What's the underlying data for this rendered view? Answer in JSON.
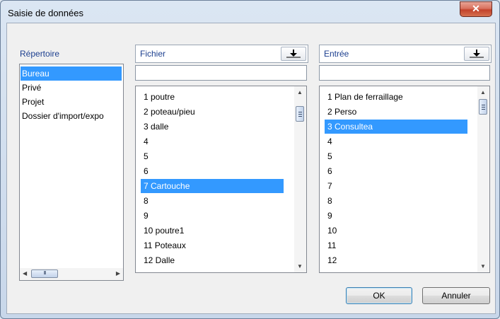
{
  "window": {
    "title": "Saisie de données",
    "close": "✕"
  },
  "directory": {
    "label": "Répertoire",
    "items": [
      "Bureau",
      "Privé",
      "Projet",
      "Dossier d'import/expo"
    ],
    "selected_index": 0,
    "hscroll_grip": "III"
  },
  "file": {
    "label": "Fichier",
    "input_value": "",
    "items": [
      "1 poutre",
      "2 poteau/pieu",
      "3 dalle",
      "4",
      "5",
      "6",
      "7 Cartouche",
      "8",
      "9",
      "10 poutre1",
      "11 Poteaux",
      "12 Dalle"
    ],
    "selected_index": 6,
    "icon": "download-icon"
  },
  "entry": {
    "label": "Entrée",
    "input_value": "",
    "items": [
      "1 Plan de ferraillage",
      "2 Perso",
      "3 Consultea",
      "4",
      "5",
      "6",
      "7",
      "8",
      "9",
      "10",
      "11",
      "12"
    ],
    "selected_index": 2,
    "icon": "download-icon"
  },
  "buttons": {
    "ok": "OK",
    "cancel": "Annuler"
  },
  "colors": {
    "selection": "#3399ff",
    "close": "#c3422b"
  }
}
